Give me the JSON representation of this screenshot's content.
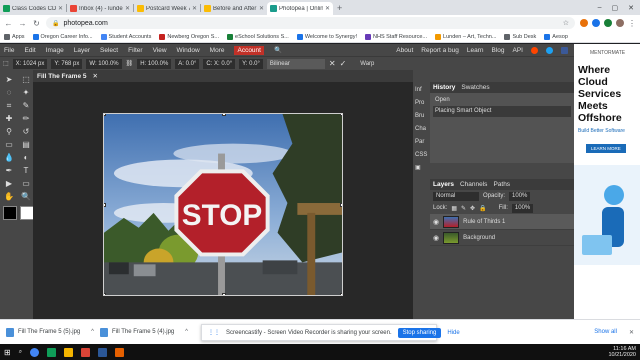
{
  "browser": {
    "tabs": [
      {
        "label": "Class Codes CDL Quarter 1 20",
        "color": "#0f9d58"
      },
      {
        "label": "Inbox (4) - lundent@newberg",
        "color": "#ea4335"
      },
      {
        "label": "Postcard Week 7 CDL - Google",
        "color": "#fbbc04"
      },
      {
        "label": "Before and After CDL - Googl",
        "color": "#fbbc04"
      },
      {
        "label": "Photopea | Online Photo Edit",
        "color": "#1a9c8c",
        "active": true
      }
    ],
    "new_tab": "+",
    "window_controls": [
      "–",
      "▢",
      "✕"
    ],
    "url": "photopea.com",
    "bookmarks": [
      {
        "label": "Apps",
        "color": "#5f6368"
      },
      {
        "label": "Oregon Career Info...",
        "color": "#1a73e8"
      },
      {
        "label": "Student Accounts",
        "color": "#4285f4"
      },
      {
        "label": "Newberg Oregon S...",
        "color": "#c5221f"
      },
      {
        "label": "eSchool Solutions S...",
        "color": "#188038"
      },
      {
        "label": "Welcome to Synergy!",
        "color": "#1a73e8"
      },
      {
        "label": "NHS Staff Resource...",
        "color": "#673ab7"
      },
      {
        "label": "Lunden – Art, Techn...",
        "color": "#f29900"
      },
      {
        "label": "Sub Desk",
        "color": "#5f6368"
      },
      {
        "label": "Aesop",
        "color": "#1a73e8"
      }
    ]
  },
  "photopea": {
    "menu": [
      "File",
      "Edit",
      "Image",
      "Layer",
      "Select",
      "Filter",
      "View",
      "Window",
      "More"
    ],
    "account": "Account",
    "menu_right": [
      "About",
      "Report a bug",
      "Learn",
      "Blog",
      "API"
    ],
    "options": {
      "x": "X: 1024 px",
      "y": "Y: 768 px",
      "w": "W: 100.0%",
      "h": "H: 100.0%",
      "a": "A: 0.0°",
      "cx": "C: X: 0.0°",
      "cy": "Y: 0.0°",
      "interp": "Bilinear",
      "warp": "Warp"
    },
    "doc_tab": "Fill The Frame 5",
    "doc_close": "✕",
    "mid_tabs": [
      "Inf",
      "Pro",
      "Bru",
      "Cha",
      "Par",
      "CSS"
    ],
    "history": {
      "tabs": [
        "History",
        "Swatches"
      ],
      "items": [
        "Open",
        "Placing Smart Object"
      ]
    },
    "layers": {
      "tabs": [
        "Layers",
        "Channels",
        "Paths"
      ],
      "blend": "Normal",
      "opacity_label": "Opacity:",
      "opacity": "100%",
      "lock_label": "Lock:",
      "fill_label": "Fill:",
      "fill": "100%",
      "items": [
        {
          "name": "Rule of Thirds 1",
          "selected": true
        },
        {
          "name": "Background",
          "selected": false
        }
      ]
    }
  },
  "ad": {
    "brand": "MENTORMATE",
    "headline": "Where Cloud Services Meets Offshore",
    "sub": "Build Better Software",
    "cta": "LEARN MORE"
  },
  "downloads": {
    "items": [
      "Fill The Frame 5 (5).jpg",
      "Fill The Frame 5 (4).jpg"
    ],
    "share_text": "Screencastify - Screen Video Recorder is sharing your screen.",
    "stop": "Stop sharing",
    "hide": "Hide",
    "show_all": "Show all"
  },
  "taskbar": {
    "time": "11:16 AM",
    "date": "10/21/2020",
    "apps": [
      "#4285f4",
      "#0f9d58",
      "#f4b400",
      "#db4437",
      "#2b5797",
      "#e66000"
    ]
  },
  "image": {
    "sign_text": "STOP"
  }
}
